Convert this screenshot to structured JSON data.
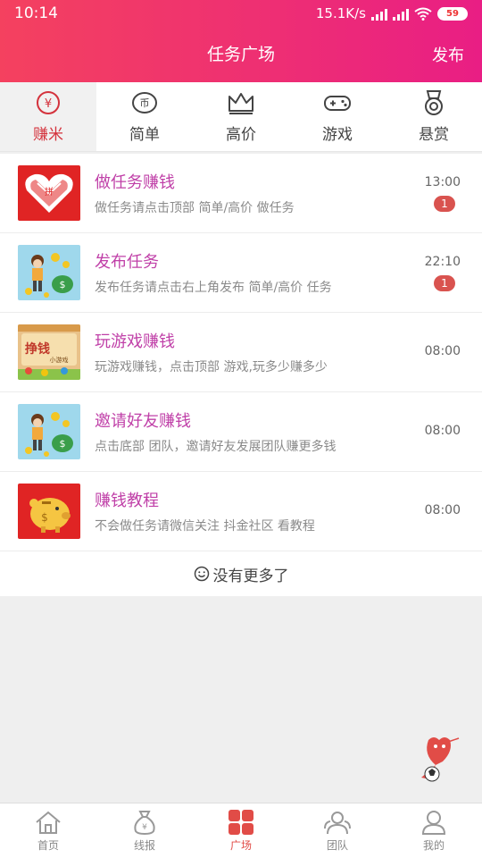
{
  "status_bar": {
    "time": "10:14",
    "network_speed": "15.1K/s",
    "battery": "59"
  },
  "header": {
    "title": "任务广场",
    "publish_label": "发布"
  },
  "tabs": [
    {
      "label": "赚米",
      "icon": "yen-circle-icon",
      "active": true
    },
    {
      "label": "简单",
      "icon": "coin-icon"
    },
    {
      "label": "高价",
      "icon": "crown-icon"
    },
    {
      "label": "游戏",
      "icon": "gamepad-icon"
    },
    {
      "label": "悬赏",
      "icon": "medal-icon"
    }
  ],
  "tasks": [
    {
      "title": "做任务赚钱",
      "desc": "做任务请点击顶部 简单/高价 做任务",
      "time": "13:00",
      "badge": "1"
    },
    {
      "title": "发布任务",
      "desc": "发布任务请点击右上角发布 简单/高价 任务",
      "time": "22:10",
      "badge": "1"
    },
    {
      "title": "玩游戏赚钱",
      "desc": "玩游戏赚钱，点击顶部 游戏,玩多少赚多少",
      "time": "08:00",
      "thumb_text": "挣钱"
    },
    {
      "title": "邀请好友赚钱",
      "desc": "点击底部 团队，邀请好友发展团队赚更多钱",
      "time": "08:00"
    },
    {
      "title": "赚钱教程",
      "desc": "不会做任务请微信关注 抖金社区 看教程",
      "time": "08:00"
    }
  ],
  "no_more_text": "没有更多了",
  "bottom_nav": [
    {
      "label": "首页",
      "icon": "home-icon"
    },
    {
      "label": "线报",
      "icon": "money-bag-icon"
    },
    {
      "label": "广场",
      "icon": "grid-icon",
      "active": true
    },
    {
      "label": "团队",
      "icon": "team-icon"
    },
    {
      "label": "我的",
      "icon": "user-icon"
    }
  ],
  "colors": {
    "header_start": "#f4415f",
    "header_end": "#e91e84",
    "accent_red": "#d4323c",
    "task_title": "#c040a8",
    "badge": "#d9534f"
  }
}
